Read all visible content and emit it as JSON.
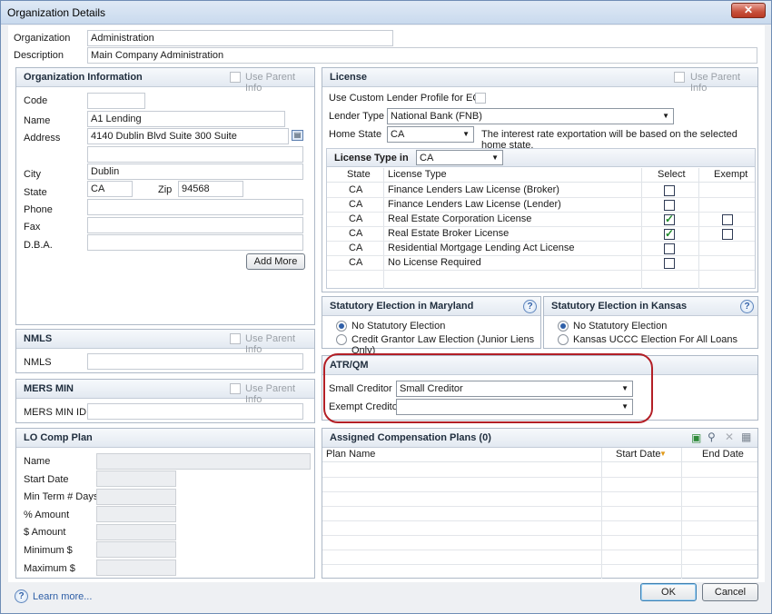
{
  "window": {
    "title": "Organization Details",
    "close_label": "✕"
  },
  "org": {
    "organization_label": "Organization",
    "organization_value": "Administration",
    "description_label": "Description",
    "description_value": "Main Company Administration"
  },
  "org_info": {
    "title": "Organization Information",
    "use_parent": "Use Parent Info",
    "code_label": "Code",
    "code_value": "",
    "name_label": "Name",
    "name_value": "A1 Lending",
    "address_label": "Address",
    "address_value": "4140 Dublin Blvd Suite 300 Suite",
    "address2_value": "",
    "city_label": "City",
    "city_value": "Dublin",
    "state_label": "State",
    "state_value": "CA",
    "zip_label": "Zip",
    "zip_value": "94568",
    "phone_label": "Phone",
    "fax_label": "Fax",
    "dba_label": "D.B.A.",
    "add_more": "Add More"
  },
  "nmls": {
    "title": "NMLS",
    "use_parent": "Use Parent Info",
    "label": "NMLS",
    "value": ""
  },
  "mers": {
    "title": "MERS MIN",
    "use_parent": "Use Parent Info",
    "label": "MERS MIN ID",
    "value": ""
  },
  "lo_comp": {
    "title": "LO Comp Plan",
    "fields": [
      "Name",
      "Start Date",
      "Min Term # Days",
      "% Amount",
      "$ Amount",
      "Minimum $",
      "Maximum $"
    ]
  },
  "license": {
    "title": "License",
    "use_parent": "Use Parent Info",
    "custom_profile": "Use Custom Lender Profile for ECS",
    "lender_type_label": "Lender Type",
    "lender_type_value": "National Bank (FNB)",
    "home_state_label": "Home State",
    "home_state_value": "CA",
    "home_state_note": "The interest rate exportation will be based on the selected home state.",
    "type_in_label": "License Type in",
    "type_in_value": "CA",
    "columns": [
      "State",
      "License Type",
      "Select",
      "Exempt"
    ],
    "rows": [
      {
        "state": "CA",
        "type": "Finance Lenders Law License (Broker)",
        "select": false,
        "exempt": null
      },
      {
        "state": "CA",
        "type": "Finance Lenders Law License (Lender)",
        "select": false,
        "exempt": null
      },
      {
        "state": "CA",
        "type": "Real Estate Corporation License",
        "select": true,
        "exempt": false
      },
      {
        "state": "CA",
        "type": "Real Estate Broker License",
        "select": true,
        "exempt": false
      },
      {
        "state": "CA",
        "type": "Residential Mortgage Lending Act License",
        "select": false,
        "exempt": null
      },
      {
        "state": "CA",
        "type": "No License Required",
        "select": false,
        "exempt": null
      }
    ]
  },
  "maryland": {
    "title": "Statutory Election in Maryland",
    "opt1": "No Statutory Election",
    "opt2": "Credit Grantor Law Election (Junior Liens Only)"
  },
  "kansas": {
    "title": "Statutory Election in Kansas",
    "opt1": "No Statutory Election",
    "opt2": "Kansas UCCC Election For All Loans"
  },
  "atr": {
    "title": "ATR/QM",
    "small_label": "Small Creditor",
    "small_value": "Small Creditor",
    "exempt_label": "Exempt Creditor",
    "exempt_value": ""
  },
  "comp_plans": {
    "title": "Assigned Compensation Plans (0)",
    "columns": [
      "Plan Name",
      "Start Date",
      "End Date"
    ]
  },
  "footer": {
    "learn_more": "Learn more...",
    "ok": "OK",
    "cancel": "Cancel"
  },
  "icons": [
    "book-icon",
    "help-icon",
    "add-icon",
    "search-icon",
    "delete-icon",
    "grid-icon",
    "sort-arrow-icon",
    "dropdown-arrow-icon"
  ],
  "colors": {
    "accent": "#2f5fa8",
    "highlight": "#b31f26",
    "check": "#1f8a2a"
  }
}
